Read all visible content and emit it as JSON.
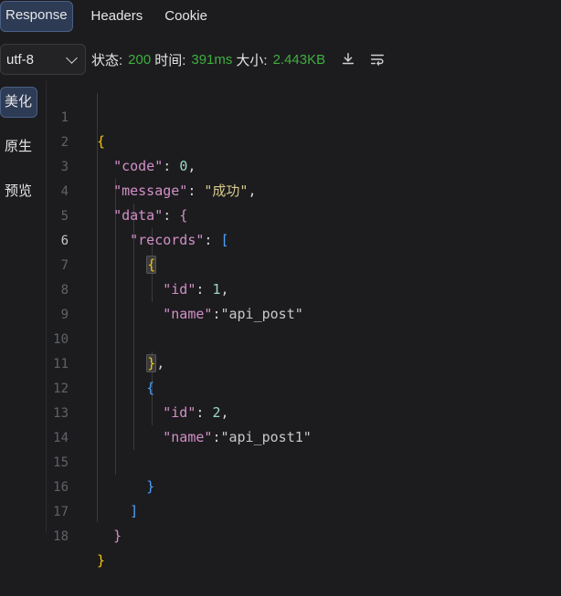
{
  "tabs": [
    {
      "label": "Response",
      "active": true
    },
    {
      "label": "Headers",
      "active": false
    },
    {
      "label": "Cookie",
      "active": false
    }
  ],
  "status": {
    "encoding": "utf-8",
    "status_label": "状态:",
    "status_value": "200",
    "time_label": "时间:",
    "time_value": "391ms",
    "size_label": "大小:",
    "size_value": "2.443KB",
    "download_icon": "download-icon",
    "wrap_icon": "wrap-text-icon",
    "value_color": "#3fae3f"
  },
  "side": [
    {
      "label": "美化",
      "active": true
    },
    {
      "label": "原生",
      "active": false
    },
    {
      "label": "预览",
      "active": false
    }
  ],
  "editor": {
    "line_numbers": [
      "1",
      "2",
      "3",
      "4",
      "5",
      "6",
      "7",
      "8",
      "9",
      "10",
      "11",
      "12",
      "13",
      "14",
      "15",
      "16",
      "17",
      "18"
    ],
    "current_line": "6",
    "tokens": {
      "open_root": "{",
      "code_key": "\"code\"",
      "code_val": "0",
      "message_key": "\"message\"",
      "message_val": "\"成功\"",
      "data_key": "\"data\"",
      "records_key": "\"records\"",
      "id_key": "\"id\"",
      "id1_val": "1",
      "name_key": "\"name\"",
      "name1_val": "\"api_post\"",
      "id2_val": "2",
      "name2_val": "\"api_post1\""
    }
  }
}
